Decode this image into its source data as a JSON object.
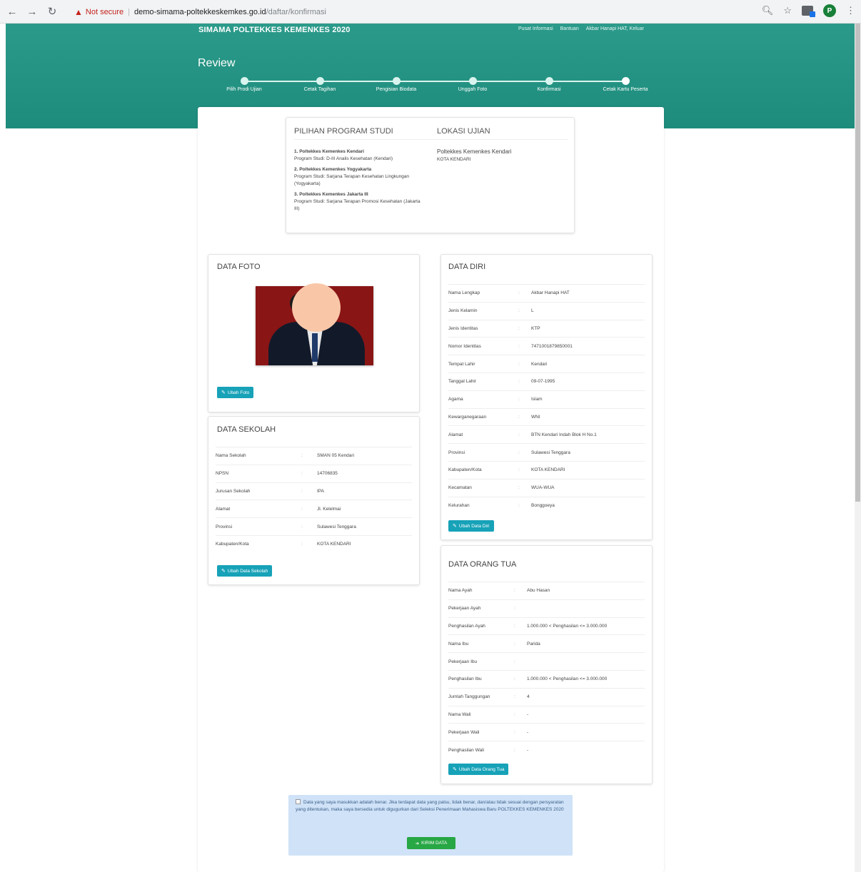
{
  "browser": {
    "not_secure": "Not secure",
    "host": "demo-simama-poltekkeskemkes.go.id",
    "path": "/daftar/konfirmasi",
    "profile_initial": "P"
  },
  "header": {
    "site_title": "SIMAMA POLTEKKES KEMENKES 2020",
    "links": [
      "Pusat Informasi",
      "Bantuan",
      "Akbar Hanapi HAT, Keluar"
    ],
    "page_title": "Review"
  },
  "steps": [
    "Pilih Prodi Ujian",
    "Cetak Tagihan",
    "Pengisian Biodata",
    "Unggah Foto",
    "Konfirmasi",
    "Cetak Kartu Peserta"
  ],
  "program": {
    "title_pilihan": "PILIHAN PROGRAM STUDI",
    "title_lokasi": "LOKASI UJIAN",
    "choices": [
      {
        "inst": "1. Poltekkes Kemenkes Kendari",
        "prodi": "Program Studi: D-III Analis Kesehatan (Kendari)"
      },
      {
        "inst": "2. Poltekkes Kemenkes Yogyakarta",
        "prodi": "Program Studi: Sarjana Terapan Kesehatan Lingkungan (Yogyakarta)"
      },
      {
        "inst": "3. Poltekkes Kemenkes Jakarta III",
        "prodi": "Program Studi: Sarjana Terapan Promosi Kesehatan (Jakarta III)"
      }
    ],
    "lokasi": "Poltekkes Kemenkes Kendari",
    "kota": "KOTA KENDARI"
  },
  "foto": {
    "title": "DATA FOTO",
    "button": "Ubah Foto"
  },
  "sekolah": {
    "title": "DATA SEKOLAH",
    "rows": [
      {
        "k": "Nama Sekolah",
        "v": "SMAN 05 Kendari"
      },
      {
        "k": "NPSN",
        "v": "14706835"
      },
      {
        "k": "Jurusan Sekolah",
        "v": "IPA"
      },
      {
        "k": "Alamat",
        "v": "Jl. Kelelmai"
      },
      {
        "k": "Provinsi",
        "v": "Sulawesi Tenggara"
      },
      {
        "k": "Kabupaten/Kota",
        "v": "KOTA KENDARI"
      }
    ],
    "button": "Ubah Data Sekolah"
  },
  "diri": {
    "title": "DATA DIRI",
    "rows": [
      {
        "k": "Nama Lengkap",
        "v": "Akbar Hanapi HAT"
      },
      {
        "k": "Jenis Kelamin",
        "v": "L"
      },
      {
        "k": "Jenis Identitas",
        "v": "KTP"
      },
      {
        "k": "Nomor Identitas",
        "v": "7471001879850001"
      },
      {
        "k": "Tempat Lahir",
        "v": "Kendari"
      },
      {
        "k": "Tanggal Lahir",
        "v": "09-07-1995"
      },
      {
        "k": "Agama",
        "v": "Islam"
      },
      {
        "k": "Kewarganegaraan",
        "v": "WNI"
      },
      {
        "k": "Alamat",
        "v": "BTN Kendari Indah Blok H No.1"
      },
      {
        "k": "Provinsi",
        "v": "Sulawesi Tenggara"
      },
      {
        "k": "Kabupaten/Kota",
        "v": "KOTA KENDARI"
      },
      {
        "k": "Kecamatan",
        "v": "WUA-WUA"
      },
      {
        "k": "Kelurahan",
        "v": "Bonggoeya"
      }
    ],
    "button": "Ubah Data Diri"
  },
  "ortu": {
    "title": "DATA ORANG TUA",
    "rows": [
      {
        "k": "Nama Ayah",
        "v": "Abu Hasan"
      },
      {
        "k": "Pekerjaan Ayah",
        "v": ""
      },
      {
        "k": "Penghasilan Ayah",
        "v": "1.000.000 < Penghasilan <= 3.000.000"
      },
      {
        "k": "Nama Ibu",
        "v": "Parida"
      },
      {
        "k": "Pekerjaan Ibu",
        "v": ""
      },
      {
        "k": "Penghasilan Ibu",
        "v": "1.000.000 < Penghasilan <= 3.000.000"
      },
      {
        "k": "Jumlah Tanggungan",
        "v": "4"
      },
      {
        "k": "Nama Wali",
        "v": "-"
      },
      {
        "k": "Pekerjaan Wali",
        "v": "-"
      },
      {
        "k": "Penghasilan Wali",
        "v": "-"
      }
    ],
    "button": "Ubah Data Orang Tua"
  },
  "confirm": {
    "text": "Data yang saya masukkan adalah benar. Jika terdapat data yang palsu, tidak benar, dan/atau tidak sesuai dengan persyaratan yang ditentukan, maka saya bersedia untuk digugurkan dari Seleksi Penerimaan Mahasiswa Baru POLTEKKES KEMENKES 2020",
    "button": "KIRIM DATA"
  }
}
